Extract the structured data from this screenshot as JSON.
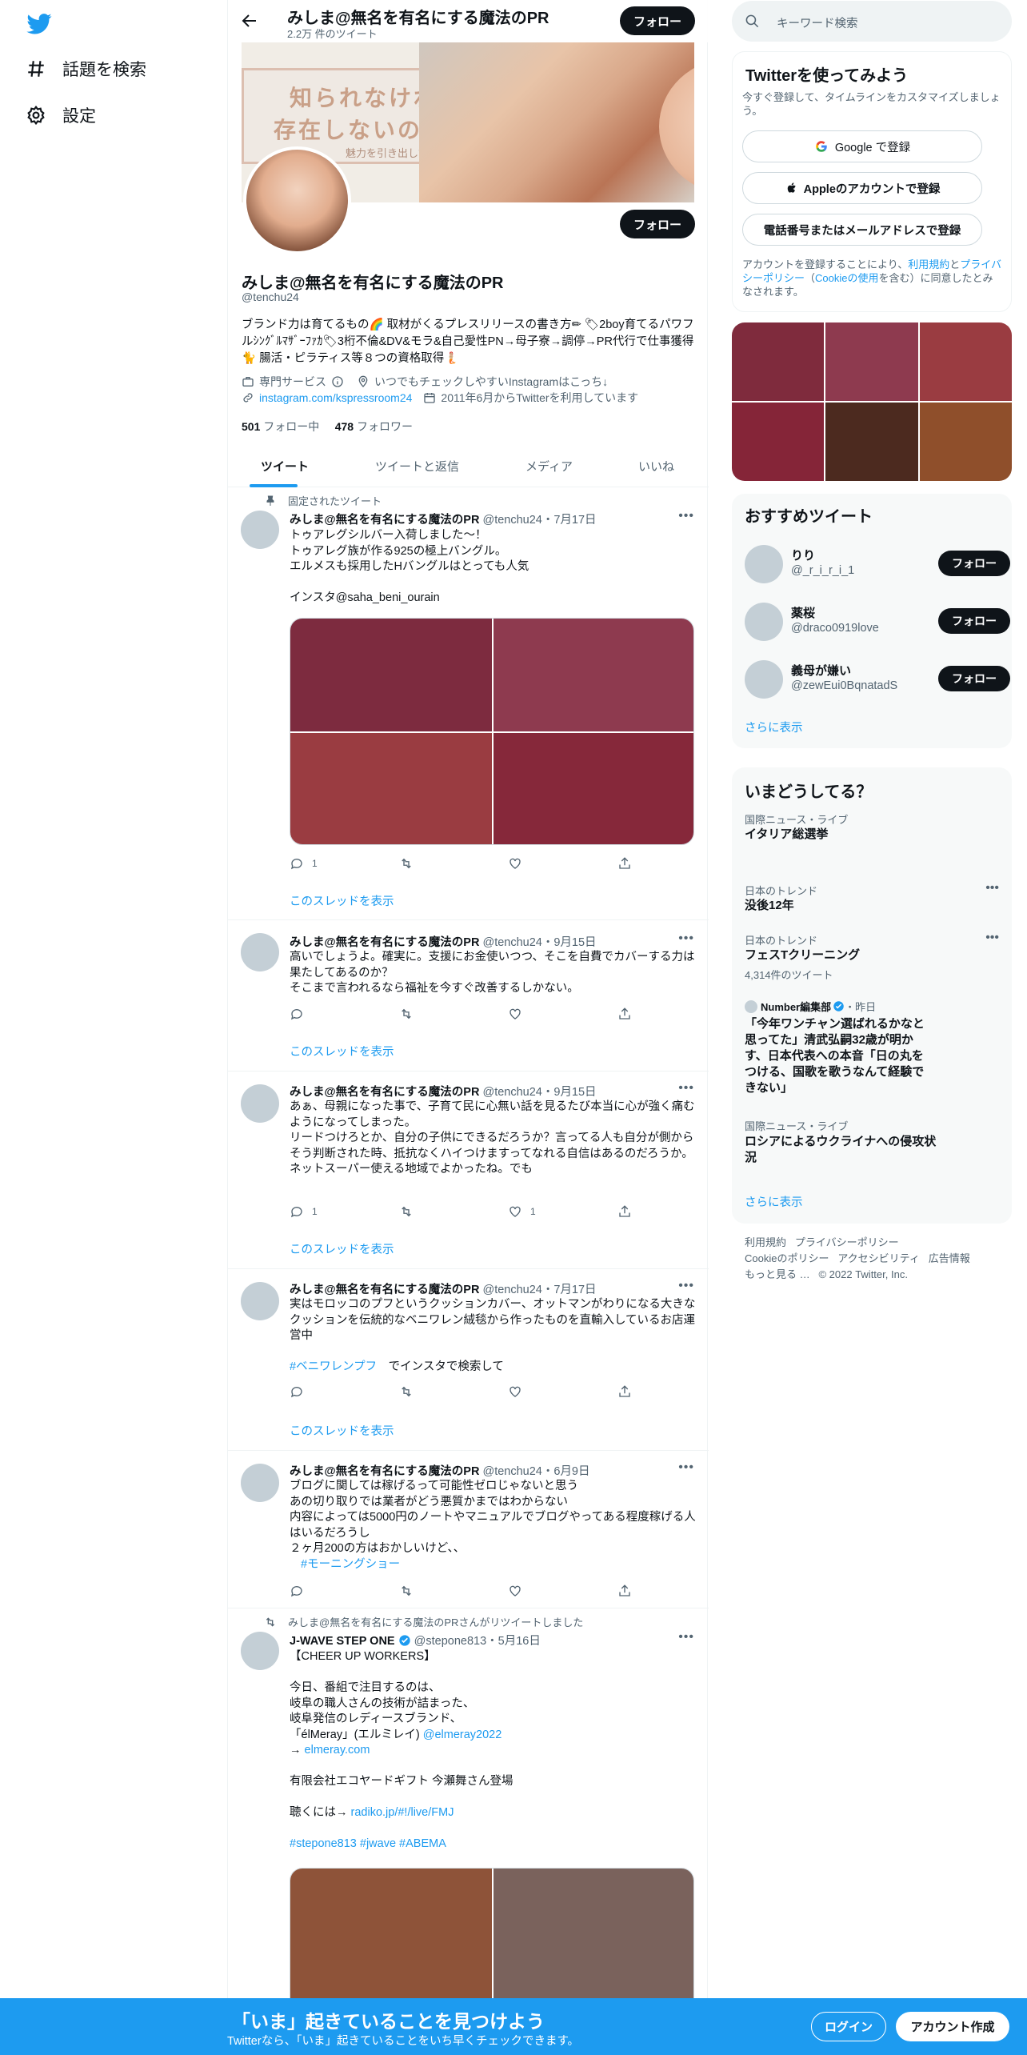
{
  "nav": {
    "explore": "話題を検索",
    "settings": "設定"
  },
  "header": {
    "title": "みしま@無名を有名にする魔法のPR",
    "tweet_count": "2.2万 件のツイート",
    "follow": "フォロー"
  },
  "banner": {
    "line1": "知られなければ",
    "line2": "存在しないのと同じ",
    "line3": "魅力を引き出して無名を有名にする魔法のPR"
  },
  "profile": {
    "follow": "フォロー",
    "name": "みしま@無名を有名にする魔法のPR",
    "handle": "@tenchu24",
    "bio": "ブランド力は育てるもの🌈 取材がくるプレスリリースの書き方✏ 🏷2boy育てるパワフルｼﾝｸﾞﾙﾏｻﾞｰﾌｧｶ🏷3桁不倫&DV&モラ&自己愛性PN→母子寮→調停→PR代行で仕事獲得🐈 腸活・ピラティス等８つの資格取得🧜🏼",
    "category": "専門サービス",
    "location": "いつでもチェックしやすいInstagramはこっち↓",
    "url": "instagram.com/kspressroom24",
    "joined": "2011年6月からTwitterを利用しています",
    "following_count": "501",
    "following_label": "フォロー中",
    "followers_count": "478",
    "followers_label": "フォロワー"
  },
  "tabs": [
    "ツイート",
    "ツイートと返信",
    "メディア",
    "いいね"
  ],
  "tweets": [
    {
      "pinned_label": "固定されたツイート",
      "name": "みしま@無名を有名にする魔法のPR",
      "meta": "@tenchu24・7月17日",
      "text": "トゥアレグシルバー入荷しました〜！\nトゥアレグ族が作る925の極上バングル。\nエルメスも採用したHバングルはとっても人気\n\nインスタ@saha_beni_ourain",
      "reply_count": "1",
      "like_count": "",
      "thread": "このスレッドを表示"
    },
    {
      "name": "みしま@無名を有名にする魔法のPR",
      "meta": "@tenchu24・9月15日",
      "text": "高いでしょうよ。確実に。支援にお金使いつつ、そこを自費でカバーする力は果たしてあるのか？\nそこまで言われるなら福祉を今すぐ改善するしかない。",
      "reply_count": "",
      "like_count": "",
      "thread": "このスレッドを表示"
    },
    {
      "name": "みしま@無名を有名にする魔法のPR",
      "meta": "@tenchu24・9月15日",
      "text": "あぁ、母親になった事で、子育て民に心無い話を見るたび本当に心が強く痛むようになってしまった。\nリードつけろとか、自分の子供にできるだろうか？言ってる人も自分が側からそう判断された時、抵抗なくハイつけますってなれる自信はあるのだろうか。\nネットスーパー使える地域でよかったね。でも",
      "reply_count": "1",
      "like_count": "1",
      "thread": "このスレッドを表示"
    },
    {
      "name": "みしま@無名を有名にする魔法のPR",
      "meta": "@tenchu24・7月17日",
      "text": "実はモロッコのプフというクッションカバー、オットマンがわりになる大きなクッションを伝統的なベニワレン絨毯から作ったものを直輸入しているお店運営中",
      "hashtag": "#ベニワレンプフ",
      "hashtag_tail": "　でインスタで検索して",
      "reply_count": "",
      "like_count": "",
      "thread": "このスレッドを表示"
    },
    {
      "name": "みしま@無名を有名にする魔法のPR",
      "meta": "@tenchu24・6月9日",
      "text": "ブログに関しては稼げるって可能性ゼロじゃないと思う\nあの切り取りでは業者がどう悪質かまではわからない\n内容によっては5000円のノートやマニュアルでブログやってある程度稼げる人はいるだろうし\n２ヶ月200の方はおかしいけど、、",
      "hashtag": "#モーニングショー",
      "reply_count": "",
      "like_count": ""
    },
    {
      "retweet_ctx": "みしま@無名を有名にする魔法のPRさんがリツイートしました",
      "name": "J-WAVE STEP ONE",
      "meta": "@stepone813・5月16日",
      "text_top": "【CHEER UP WORKERS】\n\n今日、番組で注目するのは、\n岐阜の職人さんの技術が詰まった、\n岐阜発信のレディースブランド、\n「élMeray」(エルミレイ)",
      "mention": "@elmeray2022",
      "arrow": "→ ",
      "link1": "elmeray.com",
      "text_mid": "有限会社エコヤードギフト 今瀬舞さん登場",
      "listen": "聴くには→ ",
      "link2": "radiko.jp/#!/live/FMJ",
      "hashtags": "#stepone813 #jwave #ABEMA"
    }
  ],
  "right": {
    "search_placeholder": "キーワード検索",
    "signup": {
      "title": "Twitterを使ってみよう",
      "subtitle": "今すぐ登録して、タイムラインをカスタマイズしましょう。",
      "google": "Google で登録",
      "apple": "Appleのアカウントで登録",
      "phone": "電話番号またはメールアドレスで登録",
      "terms_prefix": "アカウントを登録することにより、",
      "terms_link": "利用規約",
      "terms_and": "と",
      "privacy_link": "プライバシーポリシー",
      "cookie_open": "（",
      "cookie_link": "Cookieの使用",
      "cookie_close": "を含む）",
      "terms_suffix": "に同意したとみなされます。"
    },
    "recommend": {
      "title": "おすすめツイート",
      "users": [
        {
          "name": "りり",
          "handle": "@_r_i_r_i_1",
          "button": "フォロー"
        },
        {
          "name": "薬桜",
          "handle": "@draco0919love",
          "button": "フォロー"
        },
        {
          "name": "義母が嫌い",
          "handle": "@zewEui0BqnatadS",
          "button": "フォロー"
        }
      ],
      "more": "さらに表示"
    },
    "trends": {
      "title": "いまどうしてる？",
      "items": [
        {
          "category": "国際ニュース・ライブ",
          "title": "イタリア総選挙"
        },
        {
          "category": "日本のトレンド",
          "title": "没後12年"
        },
        {
          "category": "日本のトレンド",
          "title": "フェスTクリーニング",
          "sub": "4,314件のツイート"
        },
        {
          "source": "Number編集部",
          "time": "・昨日",
          "title": "「今年ワンチャン選ばれるかなと思ってた」清武弘嗣32歳が明かす、日本代表への本音「日の丸をつける、国歌を歌うなんて経験できない」"
        },
        {
          "category": "国際ニュース・ライブ",
          "title": "ロシアによるウクライナへの侵攻状況"
        }
      ],
      "more": "さらに表示"
    },
    "footer": {
      "terms": "利用規約",
      "privacy": "プライバシーポリシー",
      "cookie": "Cookieのポリシー",
      "access": "アクセシビリティ",
      "ads": "広告情報",
      "more": "もっと見る …",
      "copy": "© 2022 Twitter, Inc."
    }
  },
  "bottom": {
    "title": "「いま」起きていることを見つけよう",
    "subtitle": "Twitterなら、「いま」起きていることをいち早くチェックできます。",
    "login": "ログイン",
    "signup": "アカウント作成"
  },
  "colors": {
    "accent": "#1d9bf0",
    "dark_button": "#0f1419",
    "muted": "#536471",
    "card_bg": "#f7f9f9"
  },
  "media_palettes": {
    "tweet1": [
      "#7d2b3f",
      "#8e3a4f",
      "#9a3c41",
      "#86283a"
    ],
    "sidebar_photos": [
      "#7f2b3d",
      "#8e3a4f",
      "#9a3c41",
      "#852538",
      "#4c2a1f",
      "#8f4f2b"
    ],
    "retweet": [
      "#8e5339",
      "#7a625c"
    ]
  }
}
